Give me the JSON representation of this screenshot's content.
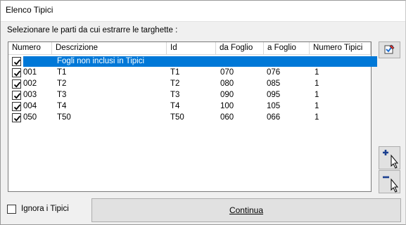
{
  "window": {
    "title": "Elenco Tipici"
  },
  "instruction": "Selezionare le parti da cui estrarre le targhette :",
  "table": {
    "columns": [
      "Numero",
      "Descrizione",
      "Id",
      "da Foglio",
      "a Foglio",
      "Numero Tipici"
    ],
    "rows": [
      {
        "checked": true,
        "numero": "",
        "descrizione": "Fogli non inclusi in Tipici",
        "id": "",
        "da_foglio": "",
        "a_foglio": "",
        "numero_tipici": ""
      },
      {
        "checked": true,
        "numero": "001",
        "descrizione": "T1",
        "id": "T1",
        "da_foglio": "070",
        "a_foglio": "076",
        "numero_tipici": "1"
      },
      {
        "checked": true,
        "numero": "002",
        "descrizione": "T2",
        "id": "T2",
        "da_foglio": "080",
        "a_foglio": "085",
        "numero_tipici": "1"
      },
      {
        "checked": true,
        "numero": "003",
        "descrizione": "T3",
        "id": "T3",
        "da_foglio": "090",
        "a_foglio": "095",
        "numero_tipici": "1"
      },
      {
        "checked": true,
        "numero": "004",
        "descrizione": "T4",
        "id": "T4",
        "da_foglio": "100",
        "a_foglio": "105",
        "numero_tipici": "1"
      },
      {
        "checked": true,
        "numero": "050",
        "descrizione": "T50",
        "id": "T50",
        "da_foglio": "060",
        "a_foglio": "066",
        "numero_tipici": "1"
      }
    ],
    "selected_row": 0
  },
  "side_buttons": {
    "select_all_icon": "check-select-icon",
    "add_icon": "add-cursor-icon",
    "remove_icon": "remove-cursor-icon"
  },
  "footer": {
    "ignore_label": "Ignora i Tipici",
    "ignore_checked": false,
    "continue_label": "Continua"
  },
  "colors": {
    "selection": "#0078d7",
    "button_face": "#e1e1e1"
  }
}
